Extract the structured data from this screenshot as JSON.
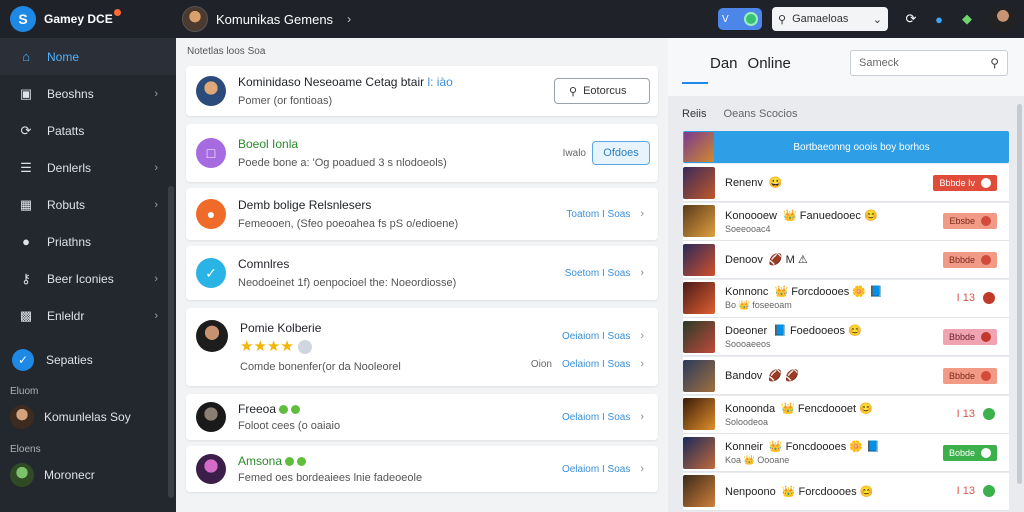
{
  "app": {
    "logo_letter": "S",
    "name": "Gamey",
    "name_suffix": "DCE"
  },
  "header": {
    "title": "Komunikas Gemens",
    "toggle_label": "V",
    "select_value": "Gamaeloas"
  },
  "sidebar": {
    "items": [
      {
        "label": "Nome",
        "icon": "home-icon",
        "active": true
      },
      {
        "label": "Beoshns",
        "icon": "bookmark-icon",
        "chevron": true
      },
      {
        "label": "Patatts",
        "icon": "refresh-icon",
        "chevron": false
      },
      {
        "label": "Denlerls",
        "icon": "list-icon",
        "chevron": true
      },
      {
        "label": "Robuts",
        "icon": "grid-icon",
        "chevron": true
      },
      {
        "label": "Priathns",
        "icon": "people-icon",
        "chevron": false
      },
      {
        "label": "Beer Iconies",
        "icon": "key-icon",
        "chevron": true
      },
      {
        "label": "Enleldr",
        "icon": "archive-icon",
        "chevron": true
      }
    ],
    "special": "Sepaties",
    "section1": "Eluom",
    "user1": "Komunlelas Soy",
    "section2": "Eloens",
    "user2": "Moronecr"
  },
  "center": {
    "header": "Notetlas loos Soa",
    "cards": [
      {
        "title": "Kominidaso Neseoame Cetag btair",
        "title_tag": "l: iào",
        "sub": "Pomer (or fontioas)",
        "button": "Eotorcus"
      },
      {
        "title": "Boeol Ionla",
        "sub": "Poede bone a: 'Og poadued 3 s nlodoeols)",
        "right_text": "Iwalo",
        "button": "Ofdoes"
      },
      {
        "title": "Demb bolige Relsnlesers",
        "sub": "Femeooen, (Sfeo poeoahea fs pS o/edioene)",
        "right_text": "Toatom I Soas"
      },
      {
        "title": "Comnlres",
        "sub": "Neodoeinet 1f) oenpocioel the: Noeordiosse)",
        "right_text": "Soetom I Soas"
      },
      {
        "title": "Pomie Kolberie",
        "sub": "Comde bonenfer(or da Nooleorel",
        "right_text": "Oeiaiom I Soas",
        "right_prefix": "Oion",
        "right_text2": "Oelaiom I Soas"
      },
      {
        "title": "Freeoa",
        "sub": "Foloot cees (o oaiaio",
        "right_text": "Oelaiom I Soas"
      },
      {
        "title": "Amsona",
        "sub": "Femed oes bordeaiees lnie fadeoeole",
        "right_text": "Oelaiom I Soas"
      }
    ],
    "rating": 4
  },
  "online": {
    "prefix": "Dan",
    "title": "Online",
    "search_placeholder": "Sameck",
    "tabs": [
      "Reiis",
      "Oeans Scocios"
    ],
    "banner": "Bortbaeonng ooois boy borhos",
    "rows": [
      {
        "name": "Renenv",
        "emoji": "😀",
        "sub": "",
        "badge": "Bbbde Iv",
        "badge_style": "red",
        "dot": "#ffffff"
      },
      {
        "name": "Konoooew",
        "emoji": "👑 Fanuedooec 😊",
        "sub": "Soeeooac4",
        "badge": "Ebsbe",
        "badge_style": "salmon",
        "dot": "#d14a3a"
      },
      {
        "name": "Denoov",
        "emoji": "🏈 M ⚠",
        "sub": "",
        "badge": "Bbbde",
        "badge_style": "salmon",
        "dot": "#d14a3a"
      },
      {
        "name": "Konnonc",
        "emoji": "👑 Forcdoooes 🌼 📘",
        "sub": "Bo 👑 foseeoam",
        "num": "I 13",
        "dot": "#c0392b"
      },
      {
        "name": "Doeoner",
        "emoji": "📘 Foedooeos 😊",
        "sub": "Soooaeeos",
        "badge": "Bbbde",
        "badge_style": "pink",
        "dot": "#c0392b"
      },
      {
        "name": "Bandov",
        "emoji": "🏈 🏈",
        "sub": "",
        "badge": "Bbbde",
        "badge_style": "salmon",
        "dot": "#d14a3a"
      },
      {
        "name": "Konoonda",
        "emoji": "👑 Fencdoooet 😊",
        "sub": "Soloodeoa",
        "num": "I 13",
        "dot": "#3cb04a"
      },
      {
        "name": "Konneir",
        "emoji": "👑 Foncdoooes 🌼 📘",
        "sub": "Koa 👑 Oooane",
        "badge": "Bobde",
        "badge_style": "green",
        "dot": "#ffffff"
      },
      {
        "name": "Nenpoono",
        "emoji": "👑 Forcdoooes 😊",
        "sub": "",
        "num": "I 13",
        "dot": "#3cb04a"
      }
    ]
  }
}
